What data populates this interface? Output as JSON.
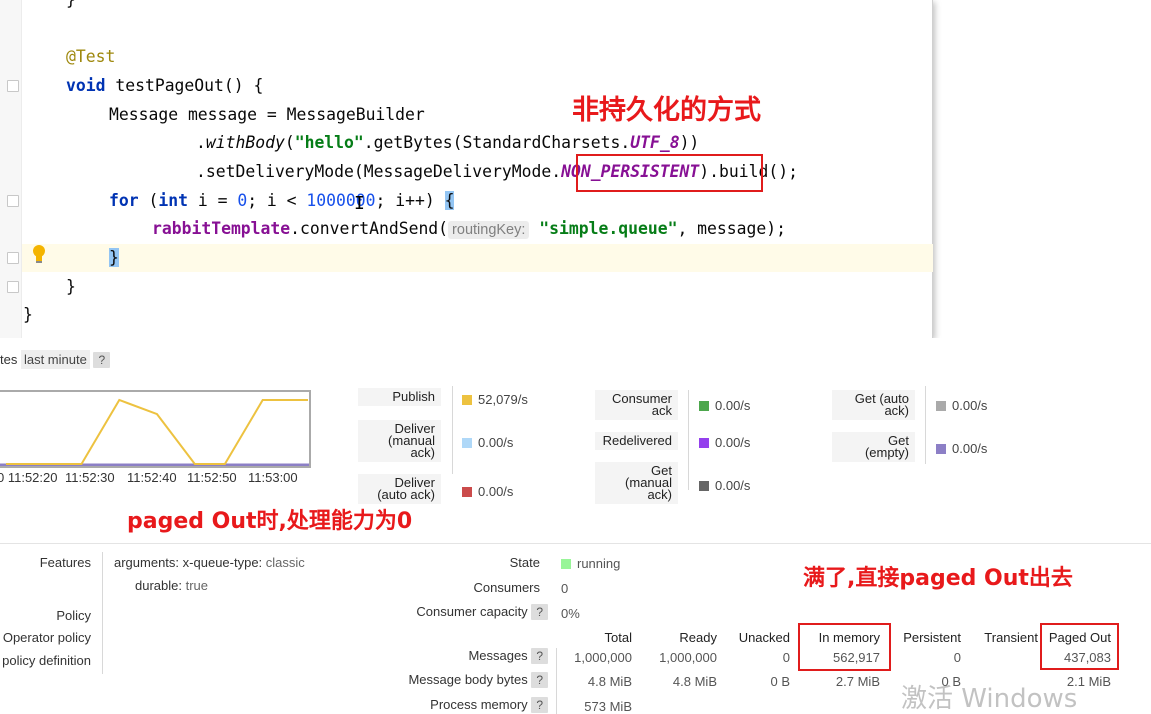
{
  "editor": {
    "closing_brace_top": "}",
    "annotation": "@Test",
    "method_kw": "void",
    "method_sig": " testPageOut() {",
    "line_msg": "Message message = MessageBuilder",
    "with_body_pre": ".",
    "with_body": "withBody",
    "with_body_open": "(",
    "hello": "\"hello\"",
    "get_bytes": ".getBytes(StandardCharsets.",
    "utf8": "UTF_8",
    "with_body_close": "))",
    "delivery_pre": ".setDeliveryMode(MessageDeliveryMode.",
    "non_persistent": "NON_PERSISTENT",
    "delivery_post": ").build();",
    "for_kw": "for",
    "for_open": " (",
    "int_kw": "int",
    "for_rest1": " i = ",
    "zero": "0",
    "for_rest2": "; i < ",
    "million": "1000000",
    "for_rest3": "; i++) ",
    "open_brace": "{",
    "rabbit": "rabbitTemplate",
    "convert": ".convertAndSend(",
    "routing_hint": "routingKey:",
    "queue_str": "\"simple.queue\"",
    "convert_end": ", message);",
    "inner_close": "}",
    "method_close": "}",
    "class_close": "}"
  },
  "annotations": {
    "non_persistent_note": "非持久化的方式",
    "paged_out_note": "paged Out时,处理能力为0",
    "full_note": "满了,直接paged Out出去"
  },
  "mgmt": {
    "range_prefix": "tes",
    "range_select": "last minute",
    "help": "?",
    "chart_ticks": [
      "0 11:52:20",
      "11:52:30",
      "11:52:40",
      "11:52:50",
      "11:53:00"
    ],
    "rates": [
      {
        "label": "Publish",
        "value": "52,079/s",
        "color": "#edc240"
      },
      {
        "label": "Deliver\n(manual\nack)",
        "value": "0.00/s",
        "color": "#afd8f8"
      },
      {
        "label": "Deliver\n(auto ack)",
        "value": "0.00/s",
        "color": "#cb4b4b"
      },
      {
        "label": "Consumer\nack",
        "value": "0.00/s",
        "color": "#4da74d"
      },
      {
        "label": "Redelivered",
        "value": "0.00/s",
        "color": "#9440ed"
      },
      {
        "label": "Get\n(manual\nack)",
        "value": "0.00/s",
        "color": "#666666"
      },
      {
        "label": "Get (auto\nack)",
        "value": "0.00/s",
        "color": "#aaaaaa"
      },
      {
        "label": "Get\n(empty)",
        "value": "0.00/s",
        "color": "#8c7fc6"
      }
    ],
    "details": {
      "features_label": "Features",
      "arguments_label": "arguments:",
      "queue_type_key": "x-queue-type:",
      "queue_type_val": "classic",
      "durable_label": "durable:",
      "durable_val": "true",
      "policy_label": "Policy",
      "operator_policy_label": "Operator policy",
      "effective_policy_label": "policy definition",
      "state_label": "State",
      "state_val": "running",
      "consumers_label": "Consumers",
      "consumers_val": "0",
      "capacity_label": "Consumer capacity",
      "capacity_val": "0%"
    },
    "table": {
      "headers": [
        "Total",
        "Ready",
        "Unacked",
        "In memory",
        "Persistent",
        "Transient",
        "Paged Out"
      ],
      "rows": [
        {
          "label": "Messages",
          "cells": [
            "1,000,000",
            "1,000,000",
            "0",
            "562,917",
            "0",
            "",
            "437,083"
          ]
        },
        {
          "label": "Message body bytes",
          "cells": [
            "4.8 MiB",
            "4.8 MiB",
            "0 B",
            "2.7 MiB",
            "0 B",
            "",
            "2.1 MiB"
          ]
        },
        {
          "label": "Process memory",
          "cells": [
            "573 MiB",
            "",
            "",
            "",
            "",
            "",
            ""
          ]
        }
      ]
    },
    "watermark": "激活 Windows"
  },
  "chart_data": {
    "type": "line",
    "x": [
      "11:52:20",
      "11:52:30",
      "11:52:40",
      "11:52:50",
      "11:53:00"
    ],
    "series": [
      {
        "name": "Publish",
        "color": "#edc240",
        "points": [
          [
            "11:52:20",
            0
          ],
          [
            "11:52:30",
            0
          ],
          [
            "11:52:35",
            1
          ],
          [
            "11:52:40",
            0.78
          ],
          [
            "11:52:45",
            0
          ],
          [
            "11:52:49",
            0
          ],
          [
            "11:52:54",
            1
          ],
          [
            "11:53:00",
            1
          ]
        ]
      }
    ]
  }
}
